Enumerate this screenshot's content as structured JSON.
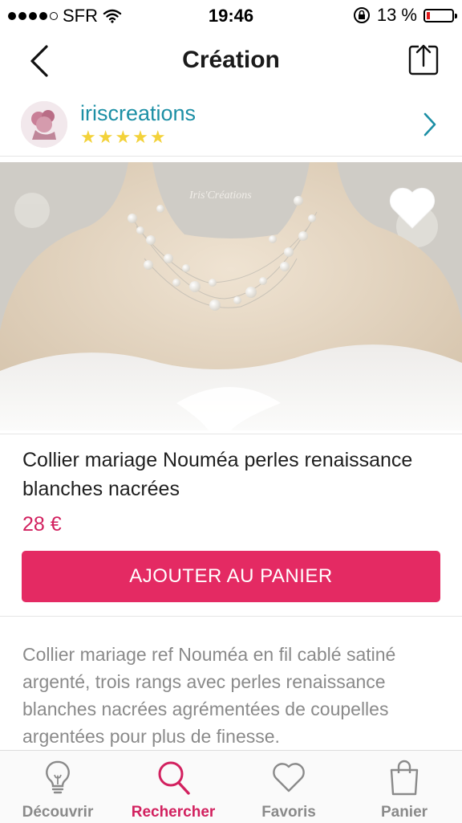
{
  "status_bar": {
    "carrier": "SFR",
    "time": "19:46",
    "battery": "13 %",
    "signal_bars": 4,
    "battery_level": 0.13
  },
  "nav": {
    "title": "Création",
    "back_icon": "chevron-left-icon",
    "share_icon": "share-icon"
  },
  "seller": {
    "name": "iriscreations",
    "stars": "★★★★★",
    "rating": 5
  },
  "photo": {
    "watermark": "Iris'Créations"
  },
  "product": {
    "title": "Collier mariage Nouméa perles renaissance blanches nacrées",
    "price": "28 €",
    "add_to_cart": "AJOUTER AU PANIER"
  },
  "description": "Collier mariage ref Nouméa en fil cablé satiné argenté, trois rangs avec  perles renaissance blanches nacrées agrémentées de coupelles argentées pour plus de finesse.",
  "tabs": [
    {
      "label": "Découvrir",
      "icon": "lightbulb-icon",
      "active": false
    },
    {
      "label": "Rechercher",
      "icon": "search-icon",
      "active": true
    },
    {
      "label": "Favoris",
      "icon": "heart-icon",
      "active": false
    },
    {
      "label": "Panier",
      "icon": "shopping-bag-icon",
      "active": false
    }
  ],
  "colors": {
    "accent": "#e42a63",
    "price": "#d2215f",
    "seller_name": "#1c8fa5",
    "stars": "#f3d23a"
  }
}
